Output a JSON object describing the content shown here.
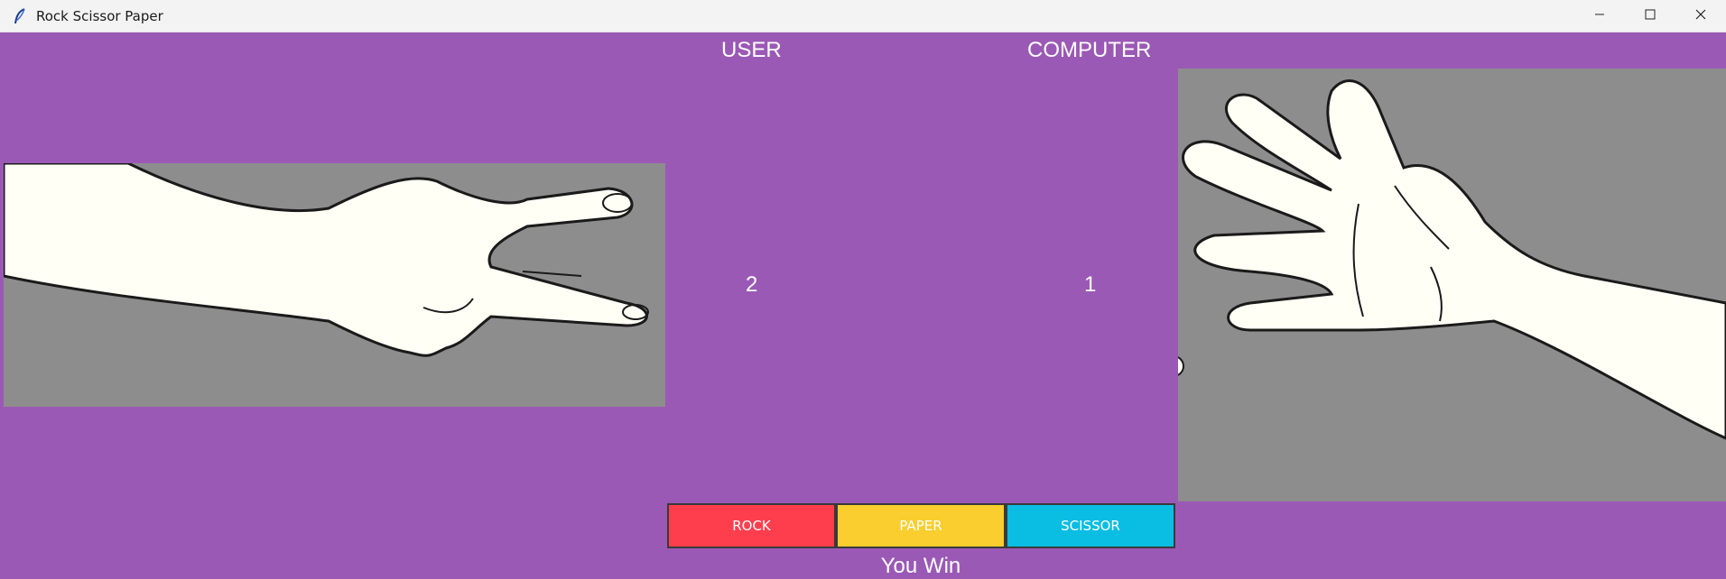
{
  "window": {
    "title": "Rock Scissor Paper"
  },
  "labels": {
    "user": "USER",
    "computer": "COMPUTER"
  },
  "scores": {
    "user": "2",
    "computer": "1"
  },
  "choices": {
    "user": "scissor",
    "computer": "paper"
  },
  "buttons": {
    "rock": "ROCK",
    "paper": "PAPER",
    "scissor": "SCISSOR"
  },
  "result": "You Win",
  "colors": {
    "background": "#9b59b6",
    "rock_button": "#ff3e4d",
    "paper_button": "#f9ce2e",
    "scissor_button": "#0abde3",
    "image_background": "#8e8d8d",
    "skin": "#fffff6"
  }
}
